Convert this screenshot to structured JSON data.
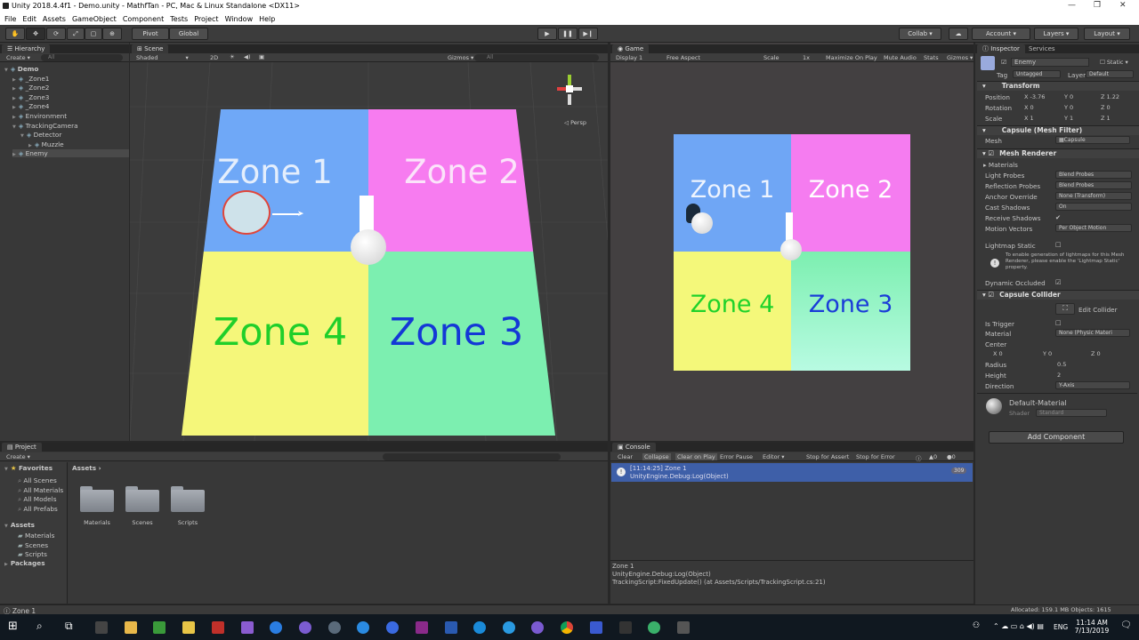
{
  "window": {
    "title": "Unity 2018.4.4f1 - Demo.unity - MathfTan - PC, Mac & Linux Standalone <DX11>"
  },
  "menu": [
    "File",
    "Edit",
    "Assets",
    "GameObject",
    "Component",
    "Tests",
    "Project",
    "Window",
    "Help"
  ],
  "toolbar": {
    "pivot": "Pivot",
    "global": "Global",
    "collab": "Collab ▾",
    "account": "Account",
    "layers": "Layers",
    "layout": "Layout"
  },
  "hierarchy": {
    "tab": "Hierarchy",
    "create": "Create ▾",
    "search_placeholder": "All",
    "items": [
      {
        "label": "Demo",
        "indent": 0
      },
      {
        "label": "_Zone1",
        "indent": 1
      },
      {
        "label": "_Zone2",
        "indent": 1
      },
      {
        "label": "_Zone3",
        "indent": 1
      },
      {
        "label": "_Zone4",
        "indent": 1
      },
      {
        "label": "Environment",
        "indent": 1
      },
      {
        "label": "TrackingCamera",
        "indent": 1
      },
      {
        "label": "Detector",
        "indent": 2
      },
      {
        "label": "Muzzle",
        "indent": 3
      },
      {
        "label": "Enemy",
        "indent": 1
      }
    ]
  },
  "scene": {
    "tab": "Scene",
    "shading": "Shaded",
    "mode2d": "2D",
    "gizmos": "Gizmos ▾",
    "gizmo_search": "All",
    "persp": "Persp",
    "zones": [
      {
        "label": "Zone 1",
        "color": "#6fa8f7",
        "text": "#e4eefc"
      },
      {
        "label": "Zone 2",
        "color": "#f77cf0",
        "text": "#fbe3fa"
      },
      {
        "label": "Zone 4",
        "color": "#f5f77a",
        "text": "#1fcf2a"
      },
      {
        "label": "Zone 3",
        "color": "#7cefb0",
        "text": "#1438d6"
      }
    ]
  },
  "game": {
    "tab": "Game",
    "display": "Display 1",
    "aspect": "Free Aspect",
    "scale_label": "Scale",
    "scale_value": "1x",
    "maximize": "Maximize On Play",
    "mute": "Mute Audio",
    "stats": "Stats",
    "gizmos": "Gizmos ▾",
    "zones": [
      {
        "label": "Zone 1",
        "color": "#6fa6f5",
        "text": "#eef4fe"
      },
      {
        "label": "Zone 2",
        "color": "#f57cf0",
        "text": "#fff"
      },
      {
        "label": "Zone 4",
        "color": "#f4f87a",
        "text": "#1fd22a"
      },
      {
        "label": "Zone 3",
        "color": "#8af3c4",
        "text": "#1a3cd8"
      }
    ]
  },
  "inspector": {
    "tab": "Inspector",
    "services": "Services",
    "object_name": "Enemy",
    "static": "Static ▾",
    "tag_label": "Tag",
    "tag": "Untagged",
    "layer_label": "Layer",
    "layer": "Default",
    "transform": {
      "title": "Transform",
      "position": {
        "label": "Position",
        "x": "-3.76",
        "y": "0",
        "z": "1.22"
      },
      "rotation": {
        "label": "Rotation",
        "x": "0",
        "y": "0",
        "z": "0"
      },
      "scale": {
        "label": "Scale",
        "x": "1",
        "y": "1",
        "z": "1"
      }
    },
    "mesh_filter": {
      "title": "Capsule (Mesh Filter)",
      "mesh_label": "Mesh",
      "mesh": "Capsule"
    },
    "mesh_renderer": {
      "title": "Mesh Renderer",
      "materials": "Materials",
      "rows": [
        {
          "label": "Light Probes",
          "value": "Blend Probes"
        },
        {
          "label": "Reflection Probes",
          "value": "Blend Probes"
        },
        {
          "label": "Anchor Override",
          "value": "None (Transform)"
        },
        {
          "label": "Cast Shadows",
          "value": "On"
        },
        {
          "label": "Receive Shadows",
          "value": "✔"
        },
        {
          "label": "Motion Vectors",
          "value": "Per Object Motion"
        }
      ],
      "lightmap_static": "Lightmap Static",
      "info": "To enable generation of lightmaps for this Mesh Renderer, please enable the 'Lightmap Static' property.",
      "dynamic_occluded": "Dynamic Occluded"
    },
    "collider": {
      "title": "Capsule Collider",
      "edit": "Edit Collider",
      "is_trigger": "Is Trigger",
      "material_label": "Material",
      "material": "None (Physic Materi",
      "center": "Center",
      "cx": "0",
      "cy": "0",
      "cz": "0",
      "radius_label": "Radius",
      "radius": "0.5",
      "height_label": "Height",
      "height": "2",
      "direction_label": "Direction",
      "direction": "Y-Axis"
    },
    "material": {
      "name": "Default-Material",
      "shader_label": "Shader",
      "shader": "Standard"
    },
    "add_component": "Add Component"
  },
  "project": {
    "tab": "Project",
    "create": "Create ▾",
    "favorites": "Favorites",
    "fav_items": [
      "All Scenes",
      "All Materials",
      "All Models",
      "All Prefabs"
    ],
    "assets": "Assets",
    "asset_items": [
      "Materials",
      "Scenes",
      "Scripts"
    ],
    "packages": "Packages",
    "breadcrumb": "Assets ›",
    "folders": [
      "Materials",
      "Scenes",
      "Scripts"
    ]
  },
  "console": {
    "tab": "Console",
    "buttons": [
      "Clear",
      "Collapse",
      "Clear on Play",
      "Error Pause",
      "Editor ▾"
    ],
    "stop_assert": "Stop for Assert",
    "stop_error": "Stop for Error",
    "count_warn": "0",
    "count_err": "0",
    "entry": {
      "line1": "[11:14:25] Zone 1",
      "line2": "UnityEngine.Debug:Log(Object)",
      "count": "309"
    },
    "detail": [
      "Zone 1",
      "UnityEngine.Debug:Log(Object)",
      "TrackingScript:FixedUpdate() (at Assets/Scripts/TrackingScript.cs:21)"
    ]
  },
  "status": {
    "left": "Zone 1",
    "right": "Allocated: 159.1 MB Objects: 1615"
  },
  "taskbar": {
    "lang": "ENG",
    "time": "11:14 AM",
    "date": "7/13/2019"
  }
}
